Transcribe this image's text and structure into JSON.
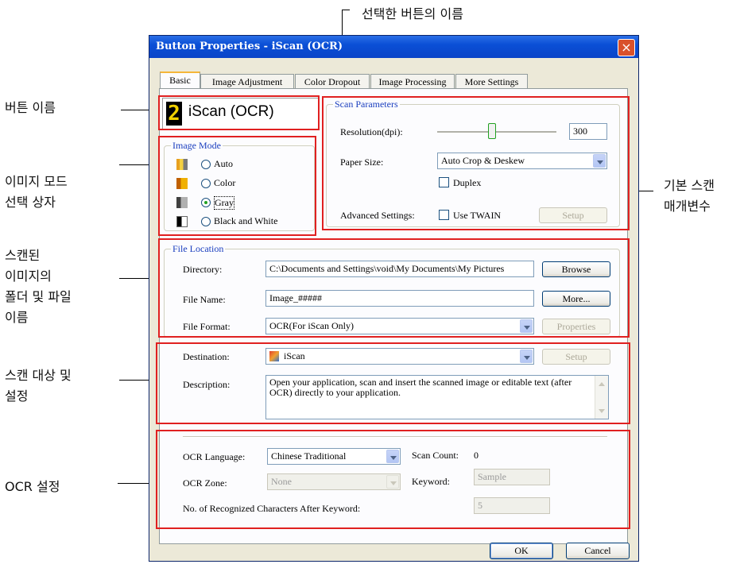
{
  "annotations": {
    "top": "선택한 버튼의 이름",
    "button_name": "버튼 이름",
    "image_mode_1": "이미지 모드",
    "image_mode_2": "선택 상자",
    "scan_params_1": "기본 스캔",
    "scan_params_2": "매개변수",
    "folder_1": "스캔된",
    "folder_2": "이미지의",
    "folder_3": "폴더 및 파일",
    "folder_4": "이름",
    "dest_1": "스캔 대상 및",
    "dest_2": "설정",
    "ocr": "OCR 설정",
    "highlight_color": "#e02020"
  },
  "window": {
    "title": "Button Properties - iScan (OCR)",
    "close_icon": "close-icon"
  },
  "tabs": [
    "Basic",
    "Image Adjustment",
    "Color Dropout",
    "Image Processing",
    "More Settings"
  ],
  "button_name": {
    "number": "2",
    "label": "iScan (OCR)"
  },
  "image_mode": {
    "legend": "Image Mode",
    "options": [
      "Auto",
      "Color",
      "Gray",
      "Black and White"
    ],
    "selected": "Gray"
  },
  "scan_params": {
    "legend": "Scan Parameters",
    "resolution_label": "Resolution(dpi):",
    "resolution_value": "300",
    "paper_size_label": "Paper Size:",
    "paper_size_value": "Auto Crop & Deskew",
    "duplex_label": "Duplex",
    "advanced_label": "Advanced Settings:",
    "use_twain_label": "Use TWAIN",
    "setup_label": "Setup"
  },
  "file_location": {
    "legend": "File Location",
    "directory_label": "Directory:",
    "directory_value": "C:\\Documents and Settings\\void\\My Documents\\My Pictures",
    "browse_label": "Browse",
    "file_name_label": "File Name:",
    "file_name_value": "Image_#####",
    "more_label": "More...",
    "file_format_label": "File Format:",
    "file_format_value": "OCR(For iScan Only)",
    "properties_label": "Properties"
  },
  "destination": {
    "destination_label": "Destination:",
    "destination_value": "iScan",
    "setup_label": "Setup",
    "description_label": "Description:",
    "description_value": "Open your application, scan and insert the scanned image or editable text (after OCR) directly to your application."
  },
  "ocr": {
    "language_label": "OCR Language:",
    "language_value": "Chinese Traditional",
    "scan_count_label": "Scan Count:",
    "scan_count_value": "0",
    "zone_label": "OCR Zone:",
    "zone_value": "None",
    "keyword_label": "Keyword:",
    "keyword_value": "Sample",
    "recognized_label": "No. of Recognized Characters After Keyword:",
    "recognized_value": "5"
  },
  "footer": {
    "ok_label": "OK",
    "cancel_label": "Cancel"
  }
}
